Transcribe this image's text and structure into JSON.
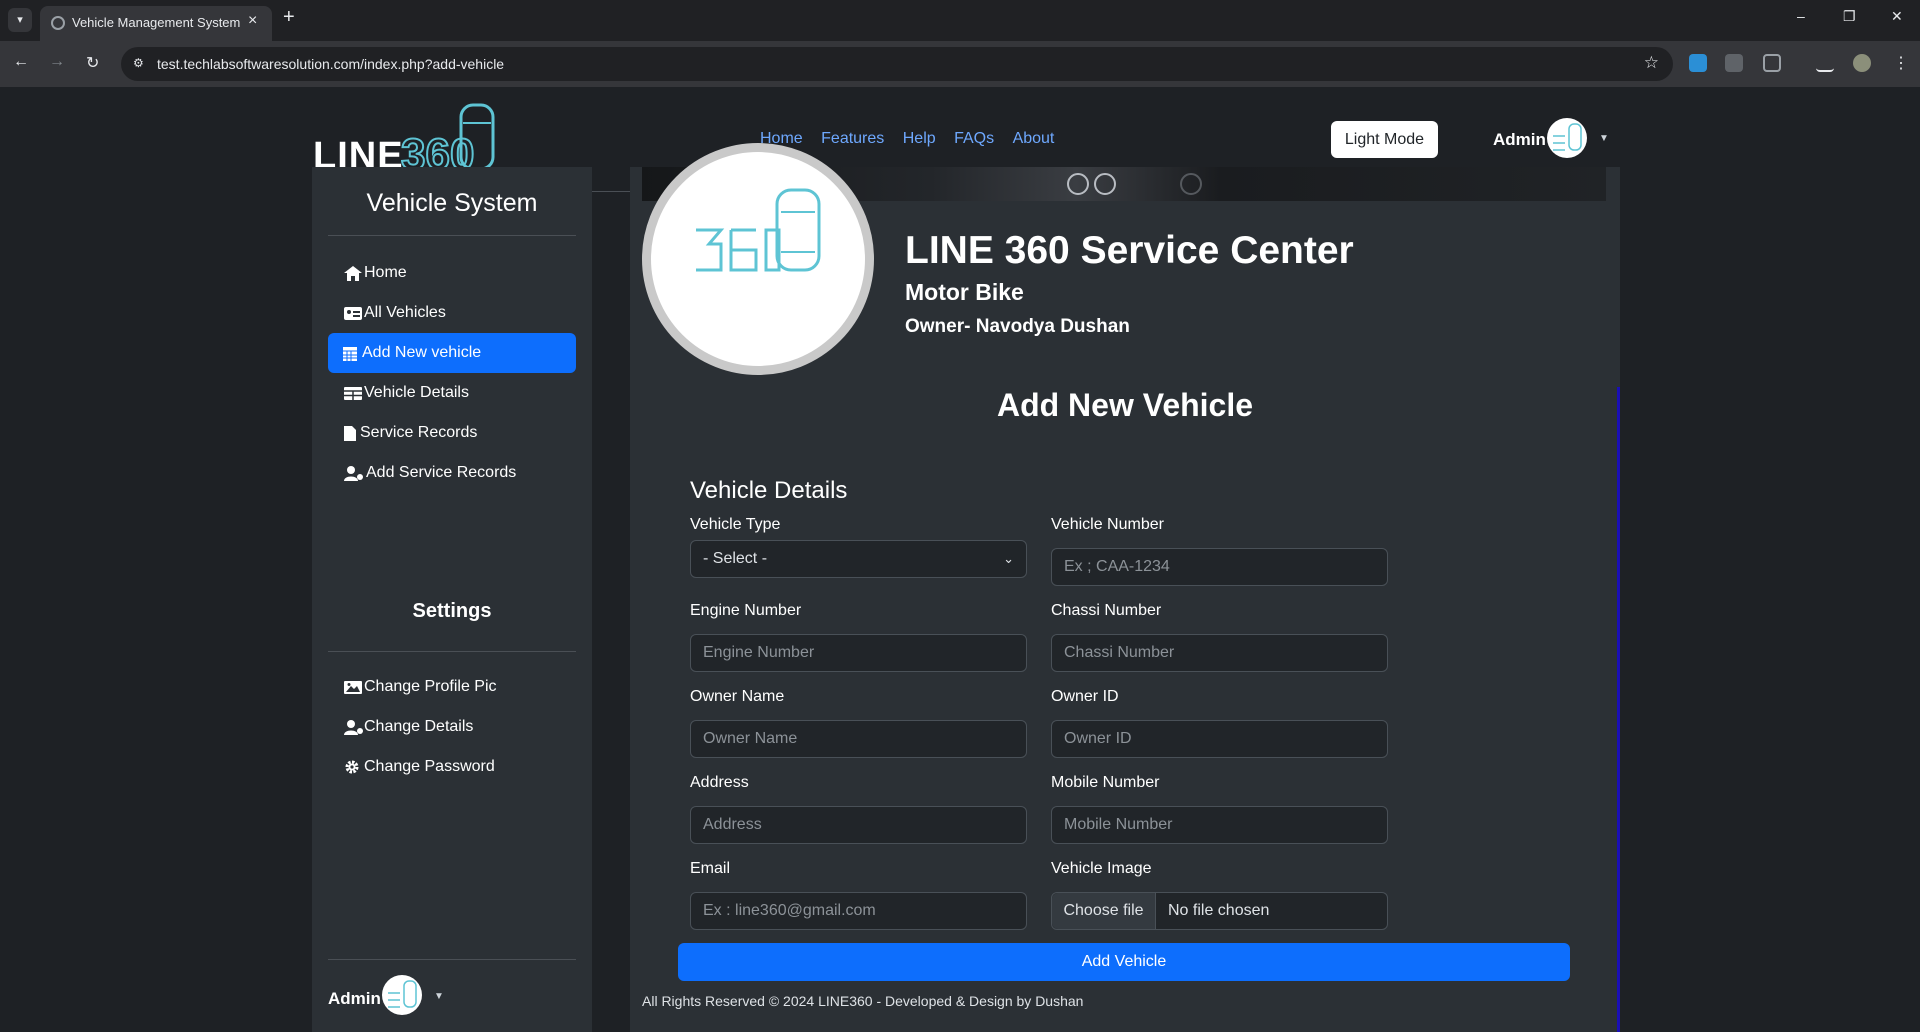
{
  "browser": {
    "tab_title": "Vehicle Management System",
    "url": "test.techlabsoftwaresolution.com/index.php?add-vehicle",
    "tab_menu_icon": "chevron-down-icon",
    "new_tab_icon": "plus-icon",
    "minimize": "–",
    "maximize": "❐",
    "close": "✕",
    "back": "←",
    "forward": "→",
    "reload": "↻",
    "star": "☆"
  },
  "header": {
    "brand_text": "LINE",
    "brand_logo_text": "360",
    "nav": [
      "Home",
      "Features",
      "Help",
      "FAQs",
      "About"
    ],
    "light_mode": "Light Mode",
    "user": "Admin"
  },
  "sidebar": {
    "title": "Vehicle System",
    "items": [
      {
        "label": "Home",
        "icon": "home-icon"
      },
      {
        "label": "All Vehicles",
        "icon": "id-card-icon"
      },
      {
        "label": "Add New vehicle",
        "icon": "calendar-icon",
        "active": true
      },
      {
        "label": "Vehicle Details",
        "icon": "table-icon"
      },
      {
        "label": "Service Records",
        "icon": "file-icon"
      },
      {
        "label": "Add Service Records",
        "icon": "user-gear-icon"
      }
    ],
    "settings_title": "Settings",
    "settings_items": [
      {
        "label": "Change Profile Pic",
        "icon": "image-icon"
      },
      {
        "label": "Change Details",
        "icon": "user-gear-icon"
      },
      {
        "label": "Change Password",
        "icon": "gear-icon"
      }
    ],
    "user": "Admin"
  },
  "profile": {
    "center_name": "LINE 360 Service Center",
    "vehicle_type": "Motor Bike",
    "owner": "Owner- Navodya Dushan"
  },
  "form": {
    "heading": "Add New Vehicle",
    "section": "Vehicle Details",
    "vehicle_type": {
      "label": "Vehicle Type",
      "value": "- Select -"
    },
    "vehicle_number": {
      "label": "Vehicle Number",
      "placeholder": "Ex ; CAA-1234"
    },
    "engine_number": {
      "label": "Engine Number",
      "placeholder": "Engine Number"
    },
    "chassi_number": {
      "label": "Chassi Number",
      "placeholder": "Chassi Number"
    },
    "owner_name": {
      "label": "Owner Name",
      "placeholder": "Owner Name"
    },
    "owner_id": {
      "label": "Owner ID",
      "placeholder": "Owner ID"
    },
    "address": {
      "label": "Address",
      "placeholder": "Address"
    },
    "mobile_number": {
      "label": "Mobile Number",
      "placeholder": "Mobile Number"
    },
    "email": {
      "label": "Email",
      "placeholder": "Ex : line360@gmail.com"
    },
    "vehicle_image": {
      "label": "Vehicle Image",
      "button": "Choose file",
      "status": "No file chosen"
    },
    "submit": "Add Vehicle"
  },
  "footer": "All Rights Reserved © 2024 LINE360 - Developed & Design by Dushan"
}
